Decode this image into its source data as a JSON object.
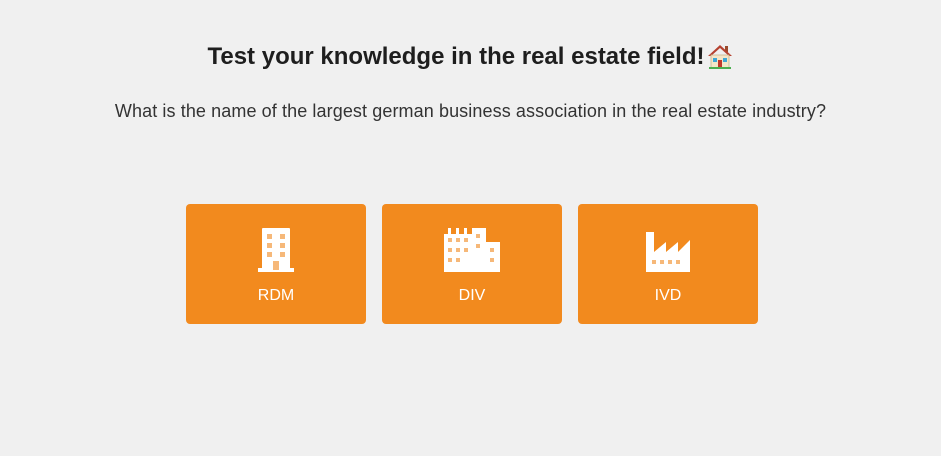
{
  "header": {
    "title": "Test your knowledge in the real estate field!",
    "title_emoji_icon": "house-icon"
  },
  "question": {
    "text": "What is the name of the largest german business association in the real estate industry?"
  },
  "options": [
    {
      "label": "RDM",
      "icon": "building-icon"
    },
    {
      "label": "DIV",
      "icon": "city-buildings-icon"
    },
    {
      "label": "IVD",
      "icon": "factory-icon"
    }
  ],
  "colors": {
    "background": "#f0f0f0",
    "accent": "#f28a1e",
    "text": "#1e1e1e"
  }
}
